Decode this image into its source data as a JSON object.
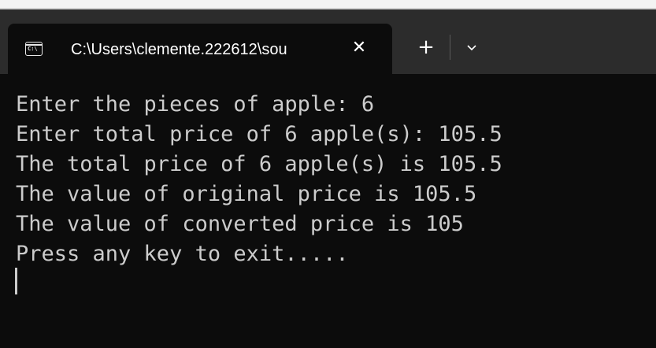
{
  "window": {
    "tab": {
      "title": "C:\\Users\\clemente.222612\\sou",
      "icon": "terminal-icon",
      "close": "✕"
    },
    "new_tab": "+",
    "dropdown_icon": "chevron-down-icon"
  },
  "terminal": {
    "lines": [
      "Enter the pieces of apple: 6",
      "Enter total price of 6 apple(s): 105.5",
      "The total price of 6 apple(s) is 105.5",
      "The value of original price is 105.5",
      "The value of converted price is 105",
      "Press any key to exit....."
    ]
  },
  "colors": {
    "terminal_bg": "#0c0c0c",
    "titlebar_bg": "#2c2c2c",
    "text": "#cccccc"
  }
}
